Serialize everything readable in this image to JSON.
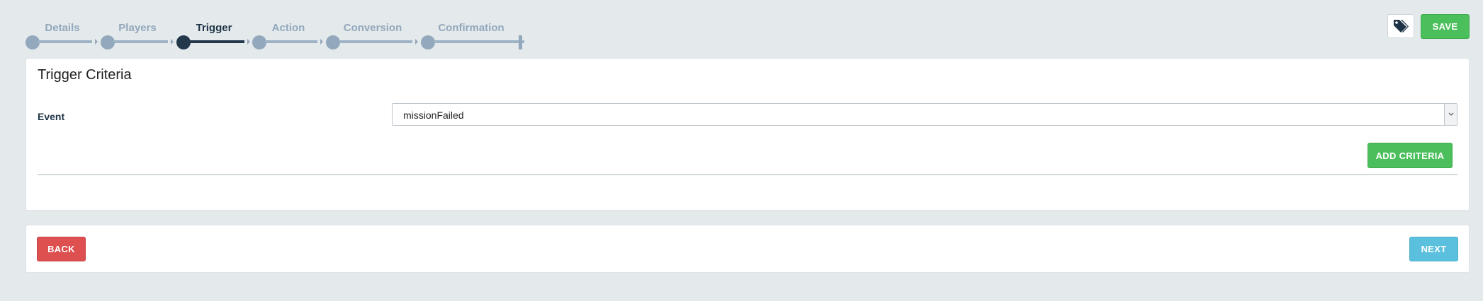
{
  "wizard": {
    "steps": [
      {
        "label": "Details",
        "active": false
      },
      {
        "label": "Players",
        "active": false
      },
      {
        "label": "Trigger",
        "active": true
      },
      {
        "label": "Action",
        "active": false
      },
      {
        "label": "Conversion",
        "active": false
      },
      {
        "label": "Confirmation",
        "active": false
      }
    ]
  },
  "toolbar": {
    "tag_icon": "tags-icon",
    "save_label": "SAVE"
  },
  "trigger_panel": {
    "title": "Trigger Criteria",
    "event_label": "Event",
    "event_value": "missionFailed",
    "add_criteria_label": "ADD CRITERIA"
  },
  "nav": {
    "back_label": "BACK",
    "next_label": "NEXT"
  },
  "colors": {
    "background": "#e4e9ec",
    "step_inactive": "#93a8bc",
    "step_active": "#24384b",
    "success": "#4cbf5d",
    "danger": "#de4f4f",
    "info": "#5bc0de"
  }
}
